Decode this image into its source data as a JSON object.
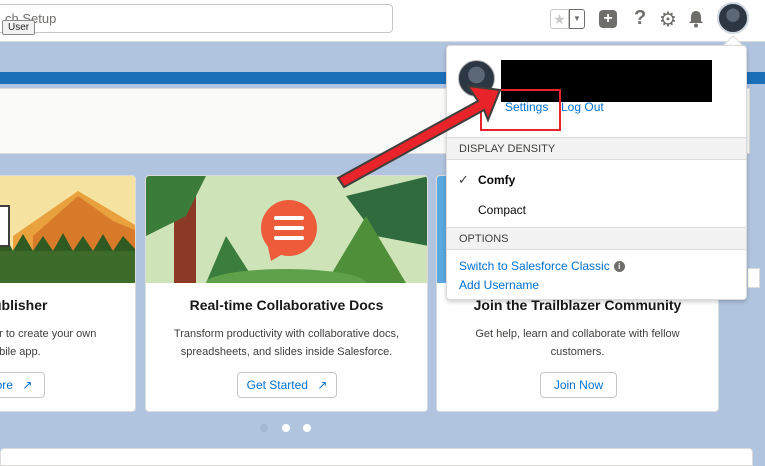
{
  "header": {
    "search_text": "ch Setup",
    "tooltip": "User"
  },
  "dropdown": {
    "settings": "Settings",
    "logout": "Log Out",
    "density_heading": "DISPLAY DENSITY",
    "density_options": [
      "Comfy",
      "Compact"
    ],
    "options_heading": "OPTIONS",
    "switch_link": "Switch to Salesforce Classic",
    "add_username": "Add Username"
  },
  "cards": [
    {
      "title": "ublisher",
      "desc": "er to create your own obile app.",
      "desc_lines": [
        "er to create your own",
        "obile app."
      ],
      "button": "ore"
    },
    {
      "title": "Real-time Collaborative Docs",
      "desc_lines": [
        "Transform productivity with collaborative docs,",
        "spreadsheets, and slides inside Salesforce."
      ],
      "button": "Get Started"
    },
    {
      "title": "Join the Trailblazer Community",
      "desc_lines": [
        "Get help, learn and collaborate with fellow",
        "customers."
      ],
      "button": "Join Now"
    }
  ],
  "colors": {
    "accent": "#0070d2",
    "highlight": "#e8232a",
    "banner": "#1b6fb8",
    "background": "#b0c4df"
  },
  "icons": [
    "favorite-star-icon",
    "chevron-down-icon",
    "plus-icon",
    "help-icon",
    "gear-icon",
    "bell-icon",
    "external-link-icon",
    "check-icon",
    "info-icon"
  ]
}
